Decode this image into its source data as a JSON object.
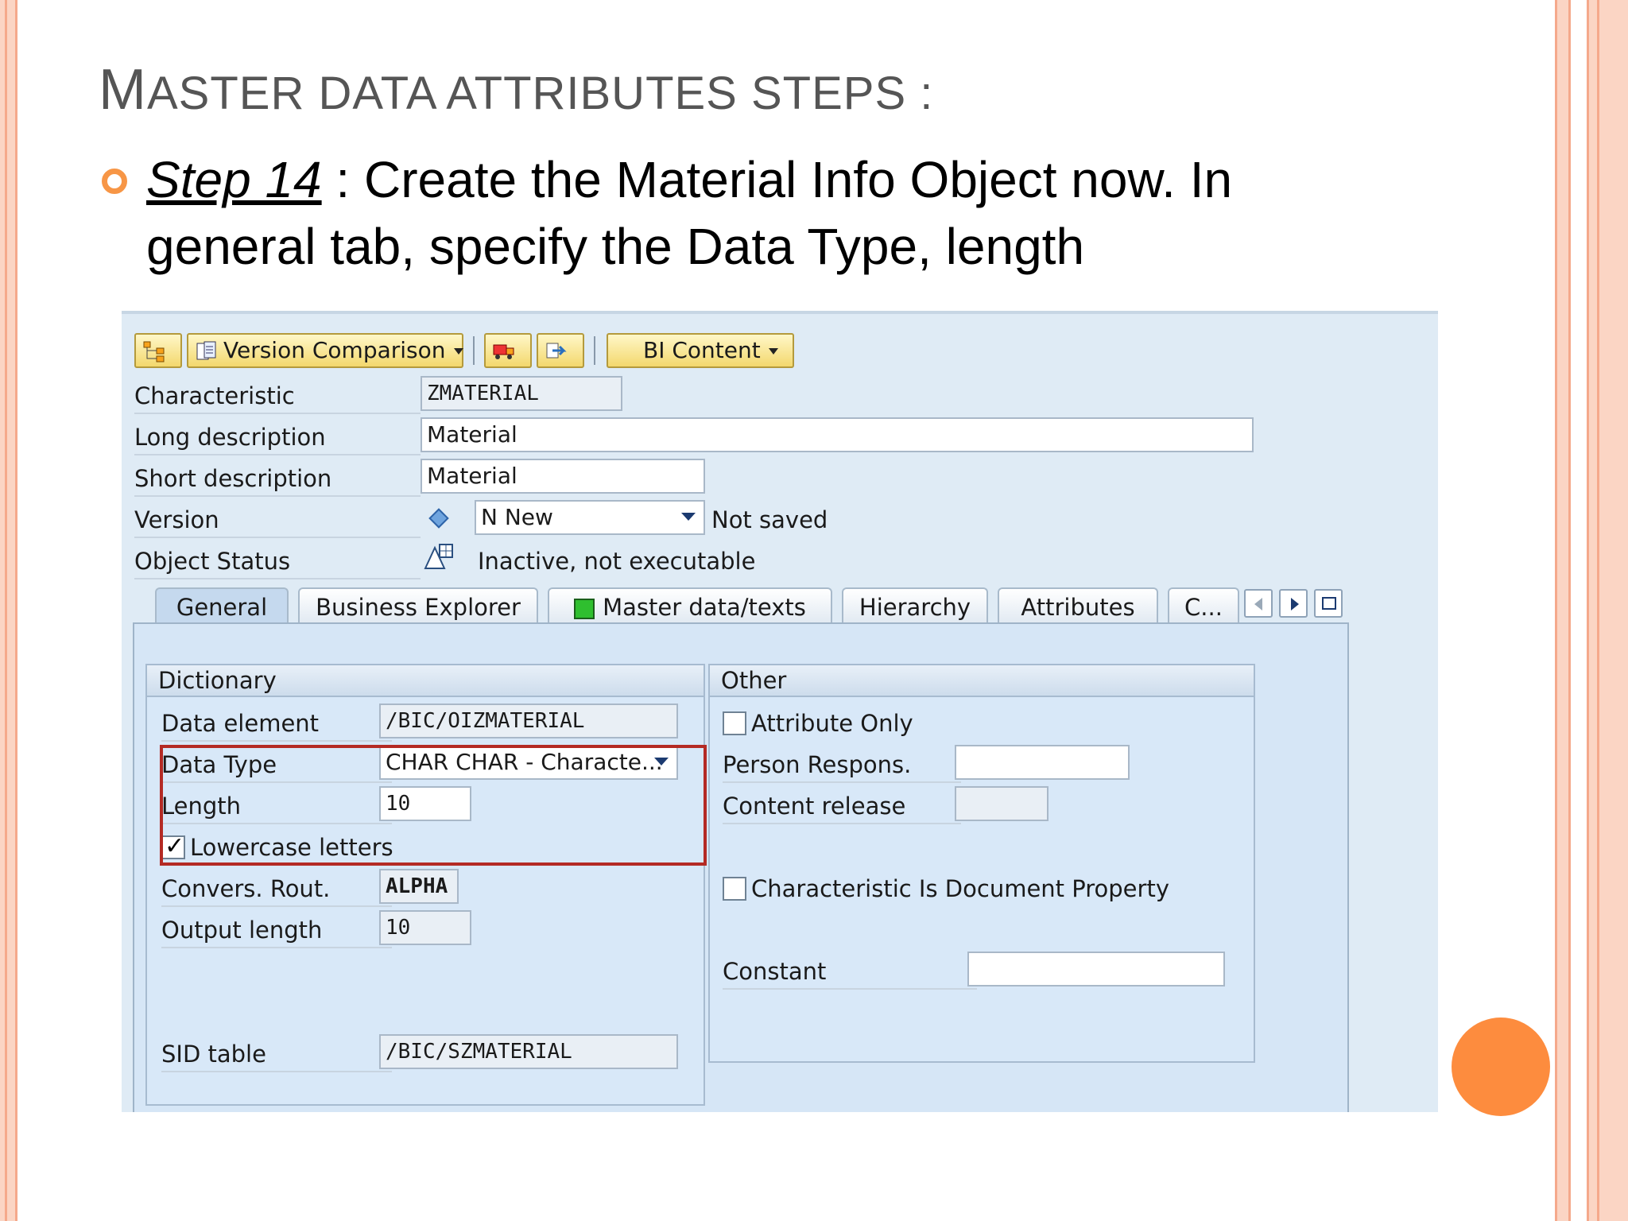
{
  "slide": {
    "title_first": "M",
    "title_rest": "ASTER DATA ATTRIBUTES STEPS :",
    "step_label": "Step 14",
    "step_text": " : Create the Material Info Object now. In general tab, specify the Data Type, length"
  },
  "toolbar": {
    "version_comparison": "Version Comparison",
    "bi_content": "BI Content"
  },
  "header": {
    "characteristic_label": "Characteristic",
    "characteristic_value": "ZMATERIAL",
    "long_desc_label": "Long description",
    "long_desc_value": "Material",
    "short_desc_label": "Short description",
    "short_desc_value": "Material",
    "version_label": "Version",
    "version_value": "N New",
    "version_status": "Not saved",
    "object_status_label": "Object Status",
    "object_status_value": "Inactive, not executable"
  },
  "tabs": [
    {
      "label": "General"
    },
    {
      "label": "Business Explorer"
    },
    {
      "label": "Master data/texts"
    },
    {
      "label": "Hierarchy"
    },
    {
      "label": "Attributes"
    },
    {
      "label": "C..."
    }
  ],
  "dictionary": {
    "title": "Dictionary",
    "data_element_label": "Data element",
    "data_element_value": "/BIC/OIZMATERIAL",
    "data_type_label": "Data Type",
    "data_type_value": "CHAR CHAR - Characte...",
    "length_label": "Length",
    "length_value": "10",
    "lowercase_label": "Lowercase letters",
    "lowercase_checked": true,
    "convers_label": "Convers. Rout.",
    "convers_value": "ALPHA",
    "output_length_label": "Output length",
    "output_length_value": "10",
    "sid_table_label": "SID table",
    "sid_table_value": "/BIC/SZMATERIAL"
  },
  "other": {
    "title": "Other",
    "attribute_only_label": "Attribute Only",
    "attribute_only_checked": false,
    "person_label": "Person Respons.",
    "person_value": "",
    "content_release_label": "Content release",
    "content_release_value": "",
    "doc_property_label": "Characteristic Is Document Property",
    "doc_property_checked": false,
    "constant_label": "Constant",
    "constant_value": ""
  },
  "colors": {
    "accent_orange": "#f79646",
    "highlight_red": "#b42a24",
    "sap_panel": "#dfebf5"
  }
}
